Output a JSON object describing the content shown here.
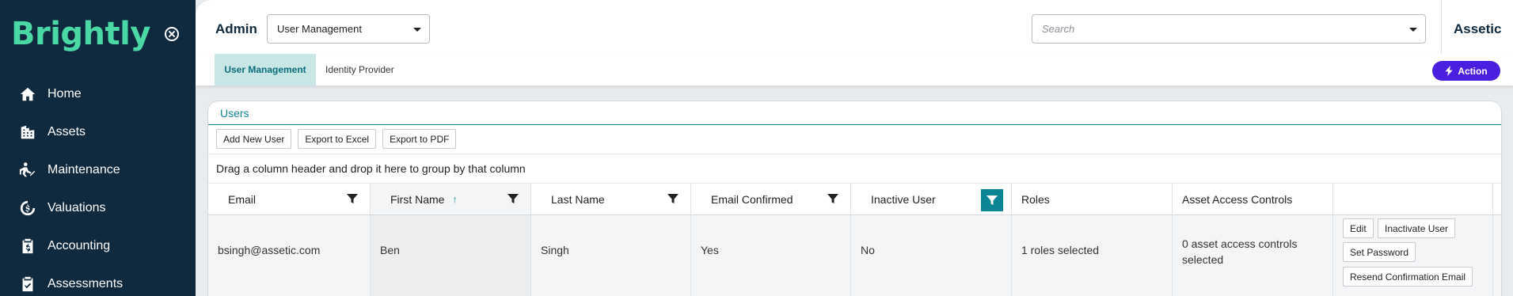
{
  "sidebar": {
    "logo": "Brightly",
    "items": [
      {
        "label": "Home",
        "icon": "home-icon"
      },
      {
        "label": "Assets",
        "icon": "building-icon"
      },
      {
        "label": "Maintenance",
        "icon": "worker-icon"
      },
      {
        "label": "Valuations",
        "icon": "dollar-gear-icon"
      },
      {
        "label": "Accounting",
        "icon": "clipboard-dollar-icon"
      },
      {
        "label": "Assessments",
        "icon": "clipboard-check-icon"
      }
    ]
  },
  "header": {
    "section": "Admin",
    "module_select": "User Management",
    "search_placeholder": "Search",
    "tenant": "Assetic"
  },
  "subtabs": {
    "items": [
      "User Management",
      "Identity Provider"
    ],
    "active": "User Management",
    "action_label": "Action"
  },
  "panel": {
    "title": "Users",
    "toolbar": [
      "Add New User",
      "Export to Excel",
      "Export to PDF"
    ],
    "group_hint": "Drag a column header and drop it here to group by that column",
    "columns": [
      "Email",
      "First Name",
      "Last Name",
      "Email Confirmed",
      "Inactive User",
      "Roles",
      "Asset Access Controls"
    ],
    "sorted_column": "First Name",
    "active_filter_column": "Inactive User",
    "rows": [
      {
        "email": "bsingh@assetic.com",
        "first_name": "Ben",
        "last_name": "Singh",
        "email_confirmed": "Yes",
        "inactive_user": "No",
        "roles": "1 roles selected",
        "asset_access": "0 asset access controls selected",
        "actions": [
          "Edit",
          "Inactivate User",
          "Set Password",
          "Resend Confirmation Email"
        ]
      }
    ]
  },
  "colors": {
    "sidebar_bg": "#0f2a3f",
    "brand_green": "#4ad9a5",
    "accent_teal": "#0b8494",
    "action_purple": "#4b1fe0"
  }
}
